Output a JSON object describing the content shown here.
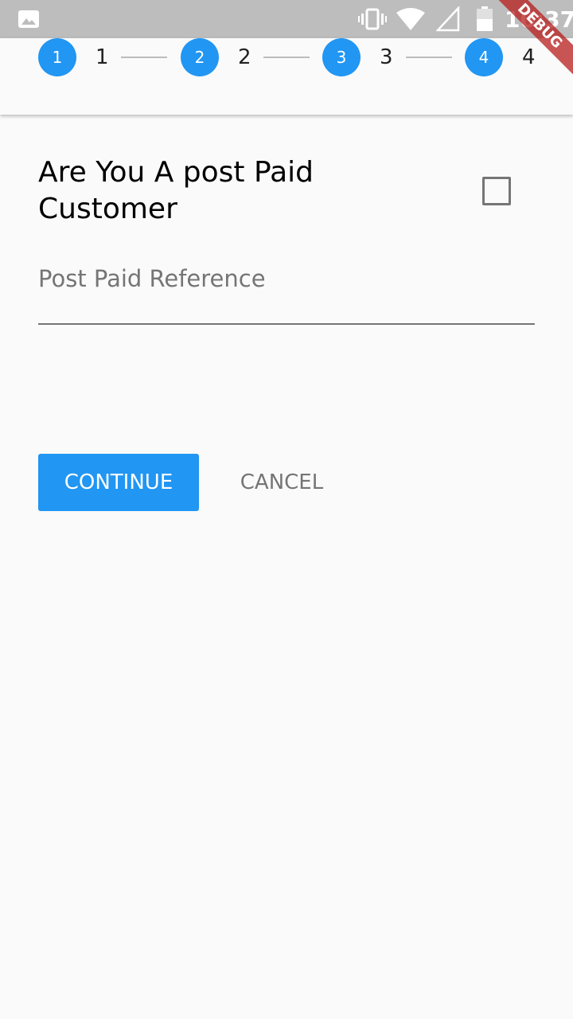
{
  "status_bar": {
    "time": "10:37",
    "icons": [
      "image-icon",
      "vibrate-icon",
      "wifi-icon",
      "signal-icon",
      "battery-icon"
    ]
  },
  "debug_banner": "DEBUG",
  "stepper": {
    "steps": [
      {
        "number": "1",
        "label": "1"
      },
      {
        "number": "2",
        "label": "2"
      },
      {
        "number": "3",
        "label": "3"
      },
      {
        "number": "4",
        "label": "4"
      }
    ],
    "accent_color": "#2196f3"
  },
  "form": {
    "question": "Are You A post Paid Customer",
    "checkbox_checked": false,
    "reference_placeholder": "Post Paid Reference",
    "reference_value": ""
  },
  "buttons": {
    "continue_label": "CONTINUE",
    "cancel_label": "CANCEL"
  }
}
